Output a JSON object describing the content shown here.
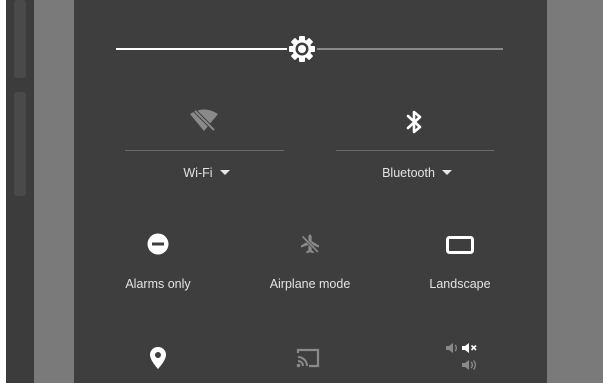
{
  "colors": {
    "panel_bg": "#3e3e3e",
    "side_gray": "#7a7a7a",
    "text": "#e3e3e3",
    "icon_active": "#ffffff",
    "icon_disabled": "#8a8a8a"
  },
  "brightness": {
    "level": 0.48,
    "icon": "brightness-icon"
  },
  "tiles_row1": [
    {
      "id": "wifi",
      "label": "Wi-Fi",
      "icon": "wifi-off-icon",
      "has_dropdown": true
    },
    {
      "id": "bluetooth",
      "label": "Bluetooth",
      "icon": "bluetooth-icon",
      "has_dropdown": true
    }
  ],
  "tiles_row2": [
    {
      "id": "dnd",
      "label": "Alarms only",
      "icon": "do-not-disturb-icon"
    },
    {
      "id": "airplane",
      "label": "Airplane mode",
      "icon": "airplane-off-icon"
    },
    {
      "id": "rotation",
      "label": "Landscape",
      "icon": "landscape-icon"
    }
  ],
  "tiles_row3": [
    {
      "id": "location",
      "icon": "location-pin-icon"
    },
    {
      "id": "cast",
      "icon": "cast-icon"
    },
    {
      "id": "volume",
      "icon": "volume-icon"
    }
  ]
}
